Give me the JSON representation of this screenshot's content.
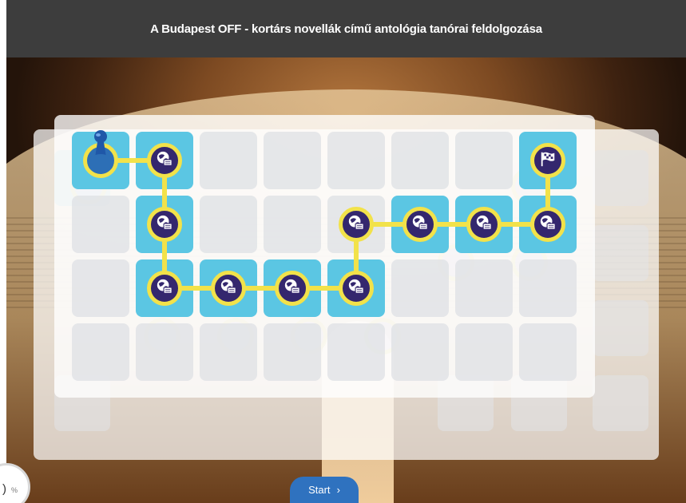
{
  "header": {
    "title": "A Budapest OFF - kortárs novellák című antológia tanórai feldolgozása"
  },
  "footer": {
    "start_label": "Start",
    "start_chevron": "›"
  },
  "progress": {
    "value": ")",
    "unit": "%"
  },
  "icons": {
    "node": "globe-book-icon",
    "finish": "checkered-flag-icon",
    "player": "pawn-icon"
  },
  "colors": {
    "header_bg": "#3d3d3d",
    "cell_active": "#5bc6e3",
    "node_fill": "#34276e",
    "track": "#f2e24a",
    "start_button": "#2f72bf"
  }
}
